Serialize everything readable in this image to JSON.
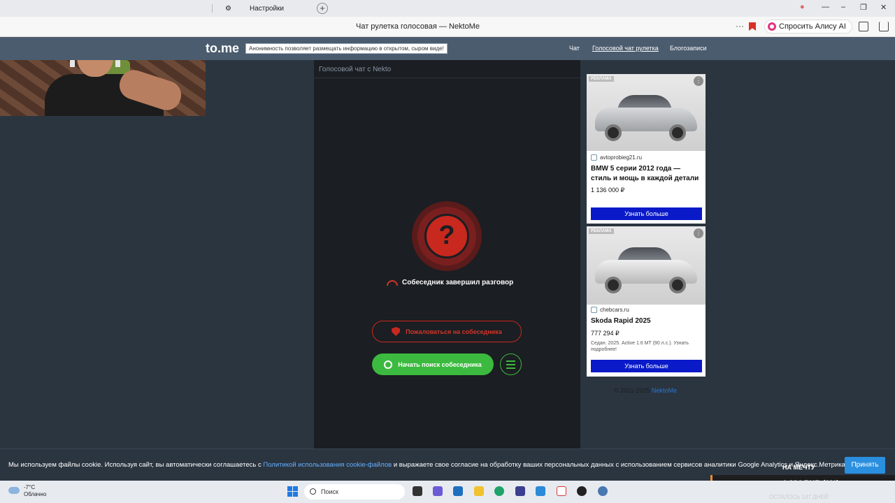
{
  "browser": {
    "tab_title": "Настройки",
    "page_title": "Чат рулетка голосовая — NektoMe",
    "alice_button": "Спросить Алису AI",
    "new_tab_label": "+",
    "more_label": "···"
  },
  "site": {
    "logo": "to.me",
    "notice": "Анонимность позволяет размещать информацию в открытом, сыром виде!",
    "nav": [
      "Чат",
      "Голосовой чат рулетка",
      "Блогозаписи"
    ]
  },
  "chat": {
    "heading": "Голосовой чат с Nekto",
    "status_symbol": "?",
    "ended_text": "Собеседник завершил разговор",
    "report_button": "Пожаловаться на собеседника",
    "search_button": "Начать поиск собеседника"
  },
  "ads": [
    {
      "label": "РЕКЛАМА",
      "domain": "avtoprobieg21.ru",
      "title": "BMW 5 серии 2012 года — стиль и мощь в каждой детали",
      "price": "1 136 000 ₽",
      "desc": "",
      "cta": "Узнать больше"
    },
    {
      "label": "РЕКЛАМА",
      "domain": "chebcars.ru",
      "title": "Skoda Rapid 2025",
      "price": "777 294 ₽",
      "desc": "Седан. 2025. Active 1.6 MT (90 л.с.). Узнать подробнее!",
      "cta": "Узнать больше"
    }
  ],
  "copyright": {
    "text": "© 2011-2025",
    "link": "NektoMe"
  },
  "cookie": {
    "text_before": "Мы используем файлы cookie. Используя сайт, вы автоматически соглашаетесь с",
    "link": "Политикой использования cookie-файлов",
    "text_after": "и выражаете свое согласие на обработку ваших персональных данных с использованием сервисов аналитики Google Analytics и Яндекс.Метрика.",
    "accept": "Принять"
  },
  "taskbar": {
    "temperature": "-7°C",
    "weather": "Облачно",
    "search_placeholder": "Поиск"
  },
  "donation": {
    "goal": "НА МЕЧТУ",
    "amount": "1 224 RUB (1%)",
    "remaining": "ОСТАЛОСЬ 147 ДНЕЙ"
  },
  "colors": {
    "accent_red": "#c8281e",
    "accent_green": "#3cba3f",
    "ad_button": "#0a1ac8"
  }
}
